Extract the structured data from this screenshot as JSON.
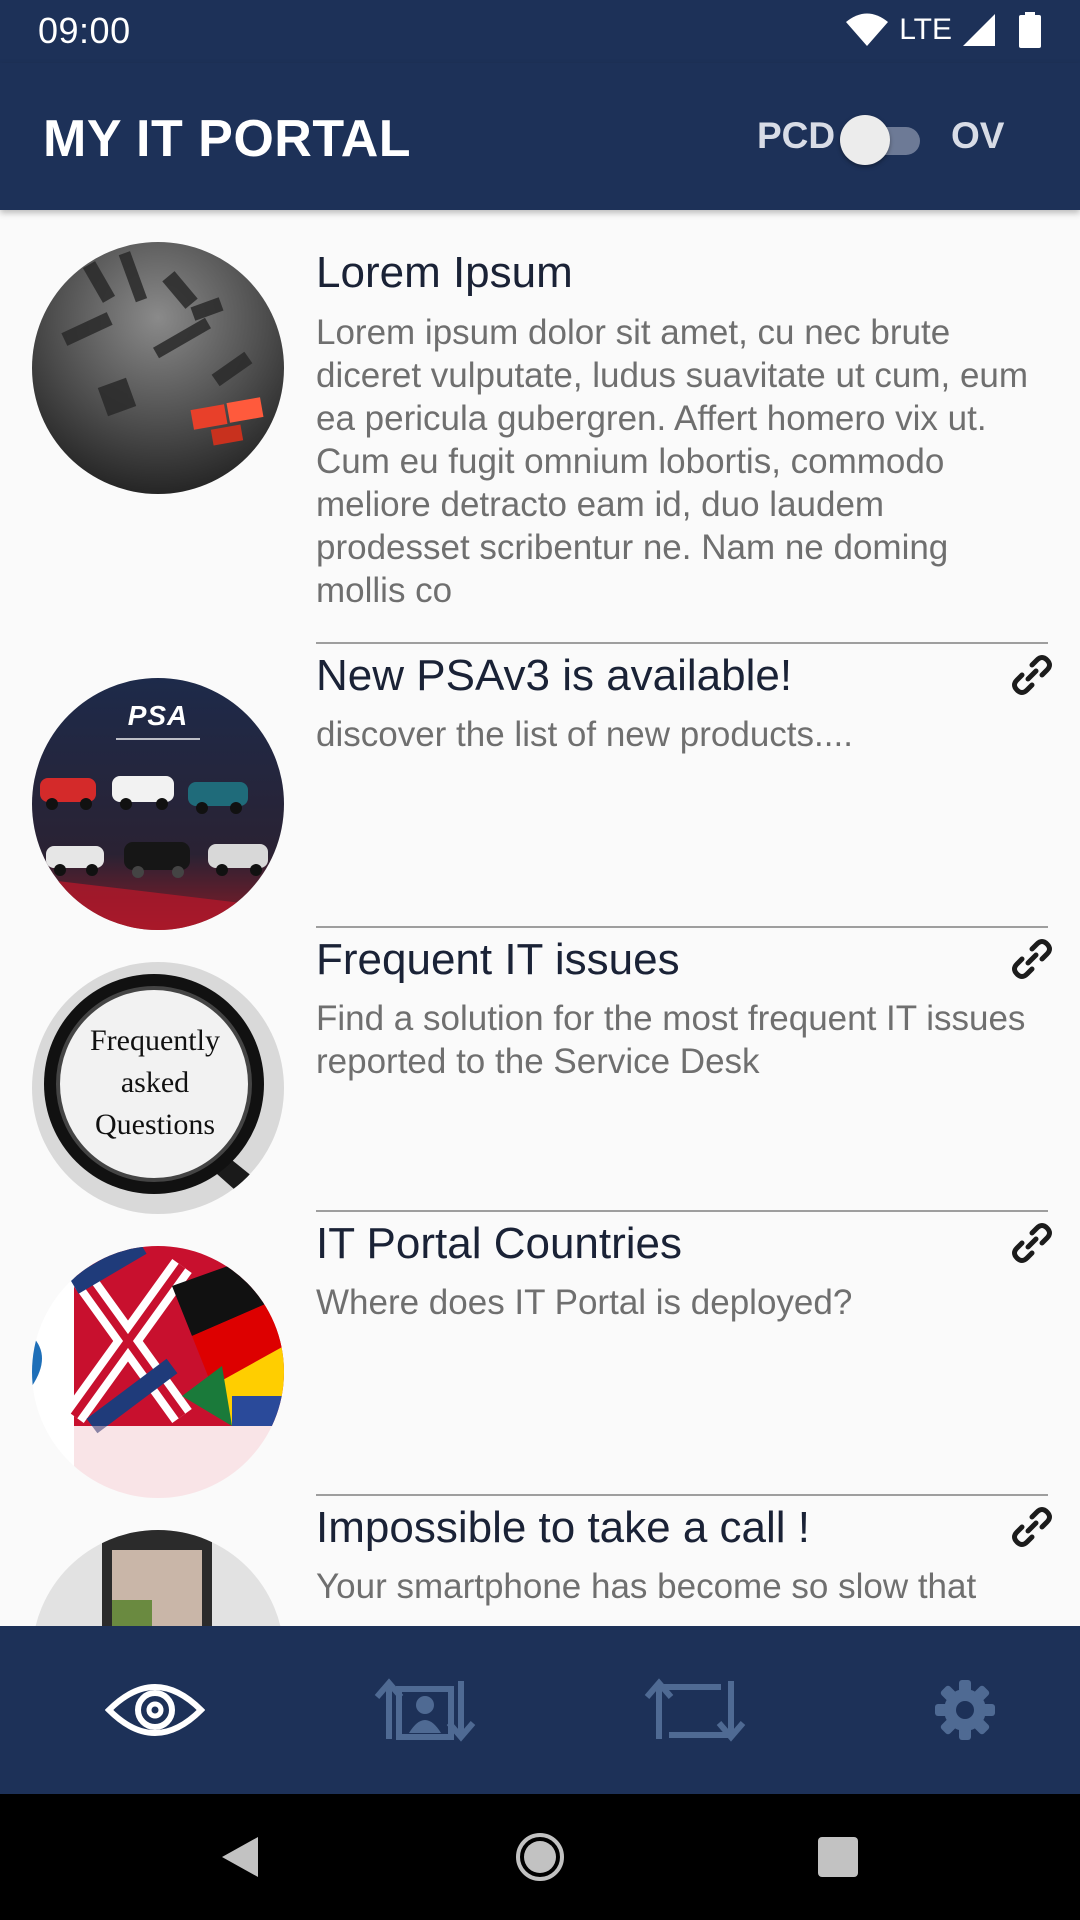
{
  "status_bar": {
    "time": "09:00",
    "network": "LTE",
    "icons": [
      "wifi-icon",
      "cell-signal-icon",
      "battery-icon"
    ]
  },
  "app_bar": {
    "title": "MY IT PORTAL",
    "toggle_left_label": "PCD",
    "toggle_right_label": "OV",
    "toggle_on": false
  },
  "news": [
    {
      "title": "Lorem Ipsum",
      "description": "Lorem ipsum dolor sit amet, cu nec brute diceret vulputate, ludus suavitate ut cum, eum ea pericula gubergren. Affert homero vix ut. Cum eu fugit omnium lobortis, commodo meliore detracto eam id, duo laudem prodesset scribentur ne. Nam ne doming mollis co",
      "has_link": false,
      "image": "dark-letters-red-accent"
    },
    {
      "title": "New PSAv3 is available!",
      "description": "discover the list of new products....",
      "has_link": true,
      "image": "psa-cars",
      "image_text": "PSA"
    },
    {
      "title": "Frequent IT issues",
      "description": "Find a solution for the most frequent IT issues reported to the Service Desk",
      "has_link": true,
      "image": "faq-magnifier",
      "image_text": [
        "Frequently",
        "asked",
        "Questions"
      ]
    },
    {
      "title": "IT Portal Countries",
      "description": "Where does IT Portal is deployed?",
      "has_link": true,
      "image": "flags"
    },
    {
      "title": "Impossible to take a call !",
      "description": "Your smartphone has become so slow that",
      "has_link": true,
      "image": "smartphone"
    }
  ],
  "bottom_nav": [
    {
      "icon": "eye-icon",
      "active": true
    },
    {
      "icon": "profile-transfer-icon",
      "active": false
    },
    {
      "icon": "repeat-icon",
      "active": false
    },
    {
      "icon": "gear-icon",
      "active": false
    }
  ],
  "colors": {
    "primary": "#1d3158",
    "background": "#fafafa",
    "title_text": "#1a2236",
    "body_text": "#6f6f6f",
    "nav_inactive": "#4f6a93",
    "accent_red": "#e8402a"
  }
}
